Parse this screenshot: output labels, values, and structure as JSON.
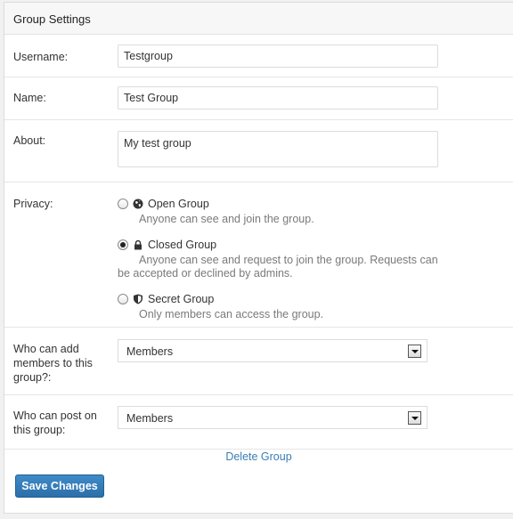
{
  "header": {
    "title": "Group Settings"
  },
  "username": {
    "label": "Username:",
    "value": "Testgroup"
  },
  "name": {
    "label": "Name:",
    "value": "Test Group"
  },
  "about": {
    "label": "About:",
    "value": "My test group"
  },
  "privacy": {
    "label": "Privacy:",
    "options": [
      {
        "title": "Open Group",
        "description": "Anyone can see and join the group.",
        "icon": "globe-icon",
        "checked": false
      },
      {
        "title": "Closed Group",
        "description_line1": "Anyone can see and request to join the group. Requests can",
        "description_line2": "be accepted or declined by admins.",
        "icon": "lock-icon",
        "checked": true
      },
      {
        "title": "Secret Group",
        "description": "Only members can access the group.",
        "icon": "shield-icon",
        "checked": false
      }
    ]
  },
  "who_can_add": {
    "label_line1": "Who can add",
    "label_line2": "members to this",
    "label_line3": "group?:",
    "selected": "Members"
  },
  "who_can_post": {
    "label_line1": "Who can post on",
    "label_line2": "this group:",
    "selected": "Members"
  },
  "actions": {
    "delete_label": "Delete Group",
    "save_label": "Save Changes",
    "accent_color": "#2f78b4"
  }
}
